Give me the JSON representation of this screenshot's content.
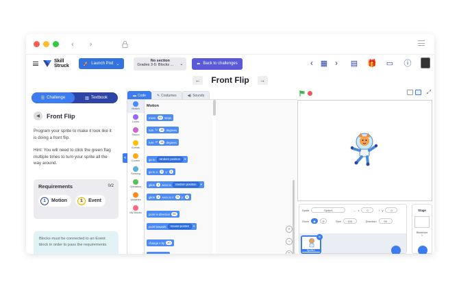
{
  "app": {
    "logo_line1": "Skill",
    "logo_line2": "Struck",
    "launch_pod": "Launch Pod",
    "section_title": "No section",
    "section_value": "Grades 3-5: Blocks ...",
    "back_label": "Back to challenges",
    "page_title": "Front Flip"
  },
  "left": {
    "tab_challenge": "Challenge",
    "tab_textbook": "Textbook",
    "challenge_name": "Front Flip",
    "desc1": "Program your sprite to make it look like it is doing a front flip.",
    "desc2": "Hint: You will need to click the green flag multiple times to turn your sprite all the way around.",
    "req_title": "Requirements",
    "req_count": "0/2",
    "req1_num": "1",
    "req1_label": "Motion",
    "req2_num": "1",
    "req2_label": "Event",
    "note": "Blocks must be connected to an Event block in order to pass the requirements"
  },
  "editor": {
    "tab_code": "Code",
    "tab_costumes": "Costumes",
    "tab_sounds": "Sounds",
    "category_header": "Motion",
    "categories": [
      "Motion",
      "Looks",
      "Sound",
      "Events",
      "Control",
      "Sensing",
      "Operators",
      "Variables",
      "My Blocks"
    ],
    "category_colors": [
      "#4c8bf5",
      "#9966ff",
      "#cf63cf",
      "#ffbf00",
      "#ffab19",
      "#5cb1d6",
      "#59c059",
      "#ff8c1a",
      "#ff6680"
    ],
    "blocks": {
      "move_a": "move",
      "move_v": "10",
      "move_b": "steps",
      "turn_r_a": "turn",
      "turn_r_v": "15",
      "turn_r_b": "degrees",
      "turn_l_a": "turn",
      "turn_l_v": "15",
      "turn_l_b": "degrees",
      "goto_a": "go to",
      "goto_d": "random position",
      "gotoxy_a": "go to x:",
      "gotoxy_x": "0",
      "gotoxy_y_label": "y:",
      "gotoxy_y": "0",
      "glide1_a": "glide",
      "glide1_v": "1",
      "glide1_b": "secs to",
      "glide1_d": "random position",
      "glide2_a": "glide",
      "glide2_v": "1",
      "glide2_b": "secs to x:",
      "glide2_x": "0",
      "glide2_y_label": "y:",
      "glide2_y": "0",
      "point_a": "point in direction",
      "point_v": "90",
      "toward_a": "point towards",
      "toward_d": "mouse-pointer",
      "changex_a": "change x by",
      "changex_v": "10"
    }
  },
  "stage": {
    "sprite_label": "Sprite",
    "sprite_name": "Sprite1",
    "x_label": "x",
    "x_value": "0",
    "y_label": "y",
    "y_value": "0",
    "show_label": "Show",
    "size_label": "Size",
    "size_value": "100",
    "direction_label": "Direction",
    "direction_value": "90",
    "thumb_name": "Sprite1",
    "stage_label": "Stage",
    "backdrops_label": "Backdrops",
    "backdrops_count": "1"
  },
  "colors": {
    "accent": "#3d7cf0",
    "brand_navy": "#2d43a5",
    "purple": "#5a5ad8",
    "green_flag": "#3db84f",
    "stop": "#e85a5a"
  }
}
